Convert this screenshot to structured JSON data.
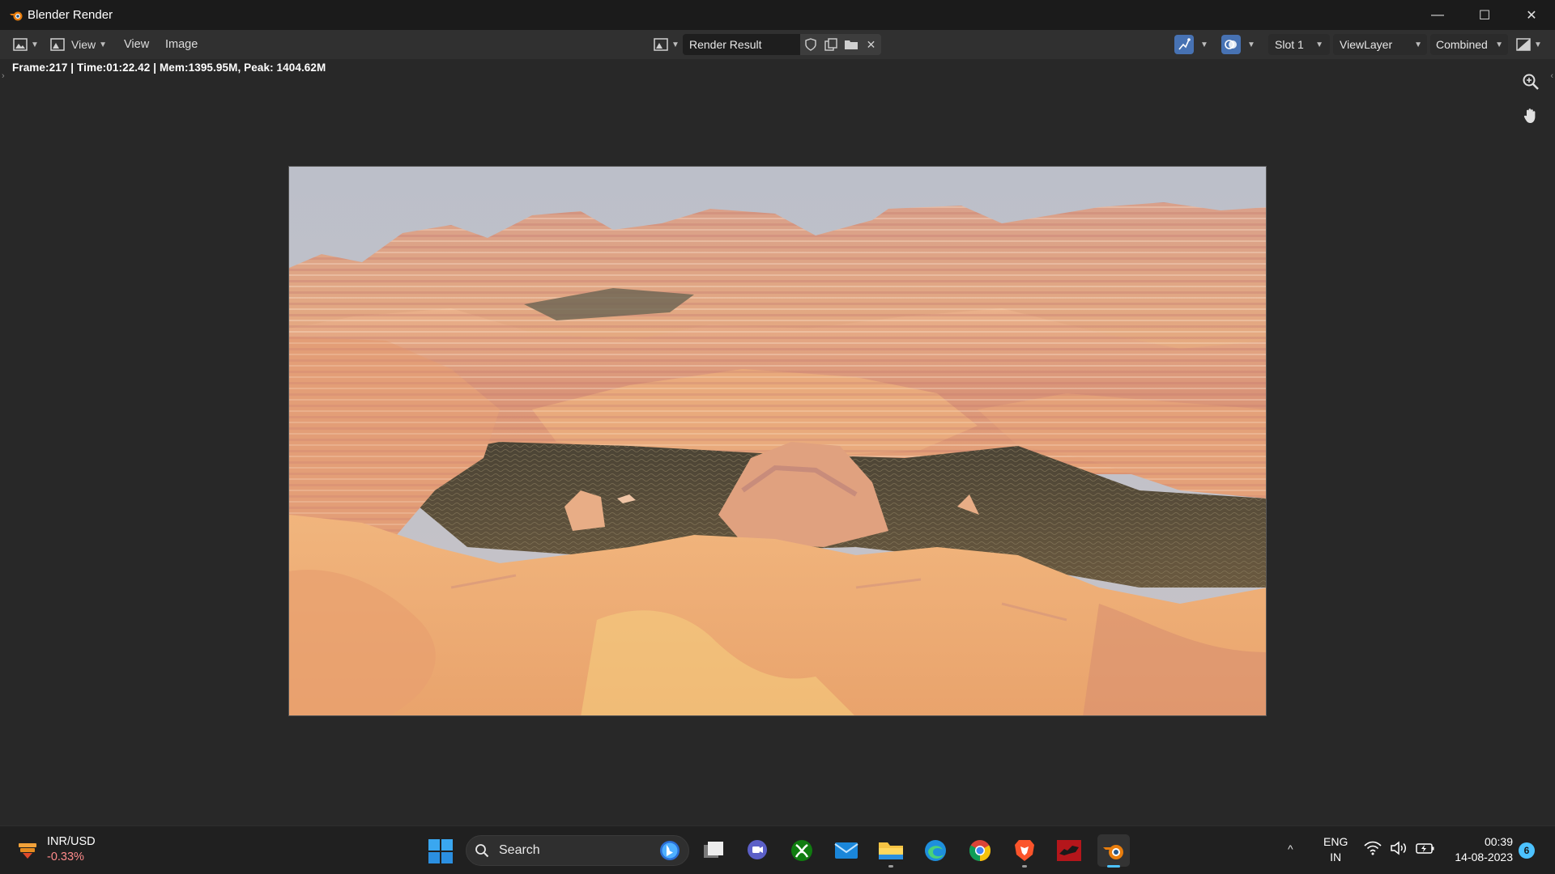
{
  "window": {
    "title": "Blender Render",
    "controls": {
      "minimize": "—",
      "maximize": "☐",
      "close": "✕"
    }
  },
  "header": {
    "view_mode_label": "View",
    "menus": {
      "view": "View",
      "image": "Image"
    },
    "image_name": "Render Result",
    "slot": "Slot 1",
    "view_layer": "ViewLayer",
    "pass": "Combined"
  },
  "viewport": {
    "render_info": "Frame:217 | Time:01:22.42 | Mem:1395.95M, Peak: 1404.62M",
    "render_subject": "desert canyon landscape render with layered sandstone mesas and dark water pools"
  },
  "taskbar": {
    "widget": {
      "title": "INR/USD",
      "change": "-0.33%",
      "icon": "currency-chart-icon"
    },
    "search_label": "Search",
    "apps": [
      {
        "name": "task-view",
        "icon": "task-view-icon"
      },
      {
        "name": "teams-chat",
        "icon": "chat-icon"
      },
      {
        "name": "xbox",
        "icon": "xbox-icon"
      },
      {
        "name": "mail",
        "icon": "mail-icon"
      },
      {
        "name": "file-explorer",
        "icon": "folder-icon"
      },
      {
        "name": "edge",
        "icon": "edge-icon"
      },
      {
        "name": "chrome",
        "icon": "chrome-icon"
      },
      {
        "name": "brave",
        "icon": "brave-icon"
      },
      {
        "name": "red-app",
        "icon": "red-app-icon"
      },
      {
        "name": "blender",
        "icon": "blender-icon"
      }
    ],
    "language_line1": "ENG",
    "language_line2": "IN",
    "time": "00:39",
    "date": "14-08-2023",
    "notification_count": "6"
  },
  "colors": {
    "accent": "#4772b3",
    "taskbar_accent": "#4cc2ff",
    "blender_orange": "#e87d0d",
    "negative_change": "#ff8b8b"
  }
}
